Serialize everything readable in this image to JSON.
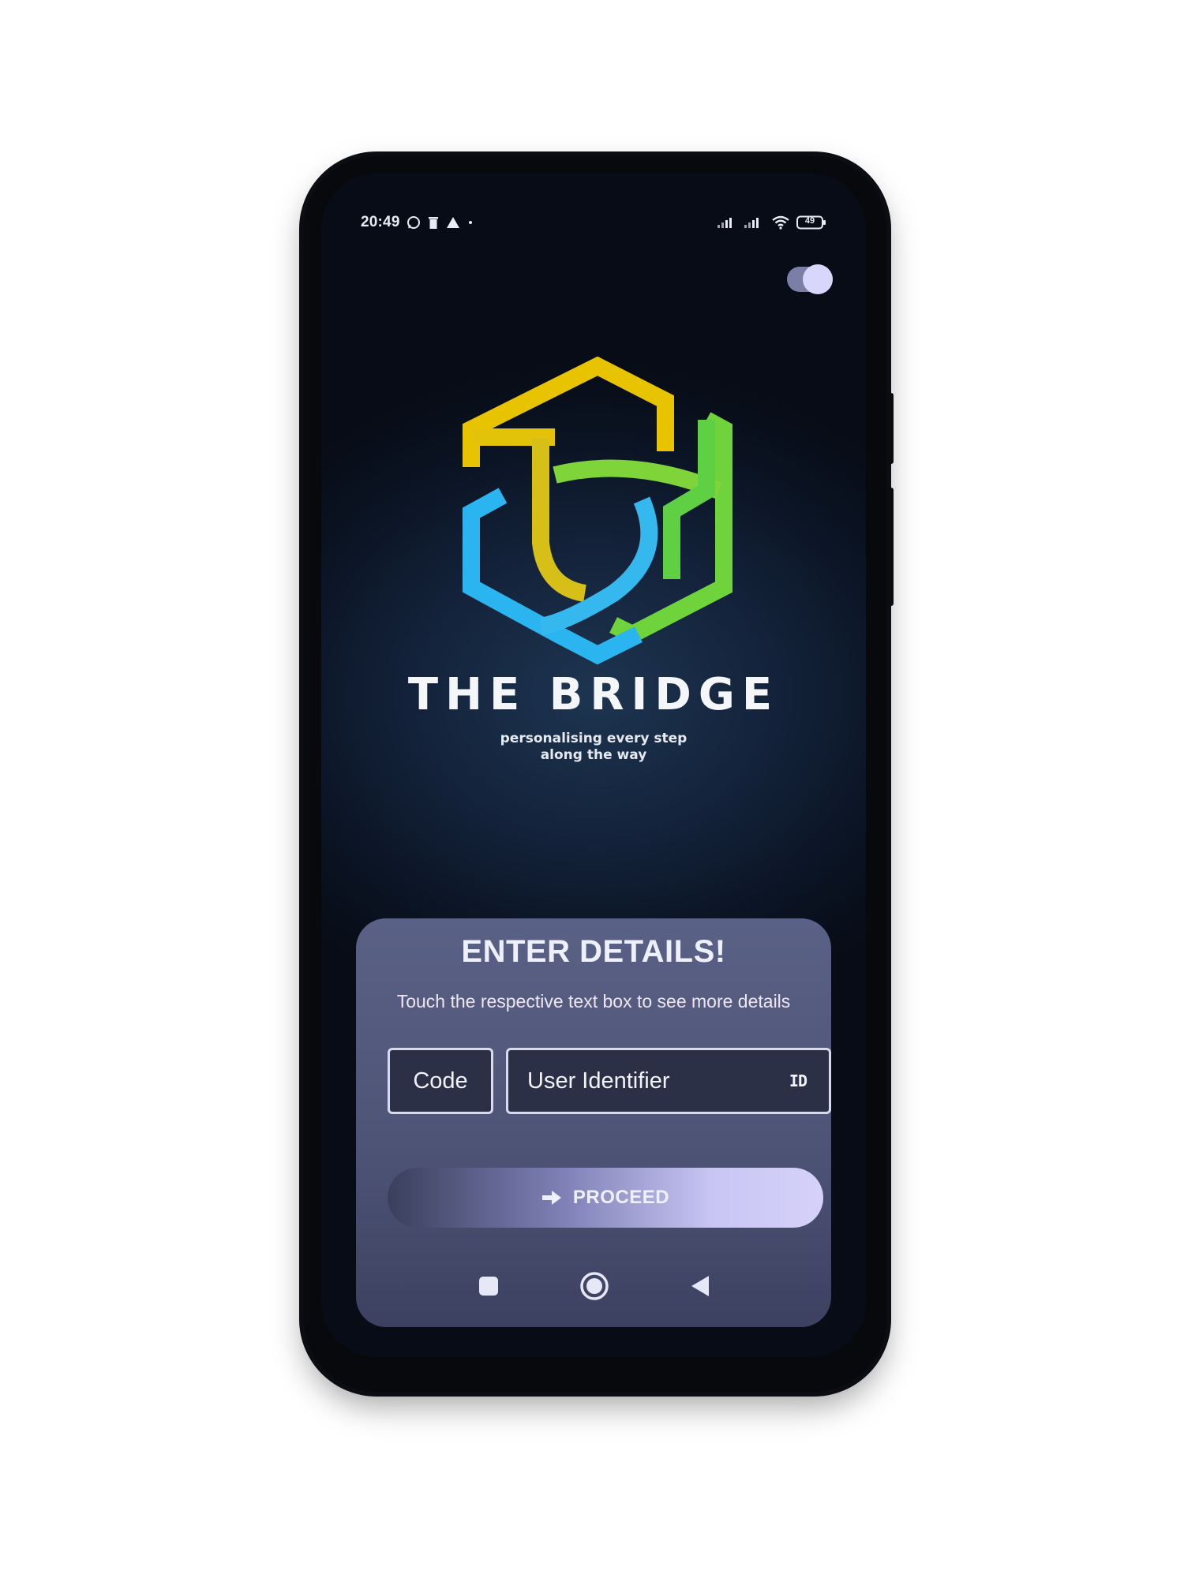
{
  "status_bar": {
    "time": "20:49",
    "battery": "49",
    "notification_icons": [
      "whatsapp-icon",
      "trash-icon",
      "warning-icon",
      "dot-icon"
    ],
    "system_icons": [
      "signal-icon",
      "signal-icon",
      "wifi-icon",
      "battery-icon"
    ]
  },
  "theme_toggle": {
    "state": "on"
  },
  "brand": {
    "title": "THE BRIDGE",
    "tagline_line1": "personalising every step",
    "tagline_line2": "along the way",
    "logo_colors": {
      "yellow": "#e7c400",
      "green": "#6ed33a",
      "blue": "#29b6f6"
    }
  },
  "card": {
    "title": "ENTER DETAILS!",
    "subtitle": "Touch the respective text box to see more details",
    "code_field": {
      "placeholder": "Code"
    },
    "user_field": {
      "placeholder": "User Identifier",
      "icon": "ID"
    },
    "proceed_label": "PROCEED"
  },
  "nav_bar": {
    "buttons": [
      "recents-square-icon",
      "home-circle-icon",
      "back-triangle-icon"
    ]
  },
  "colors": {
    "screen_bg": "#0f1b2e",
    "card_bg": "#535a7d",
    "accent": "#cfcaf8"
  }
}
